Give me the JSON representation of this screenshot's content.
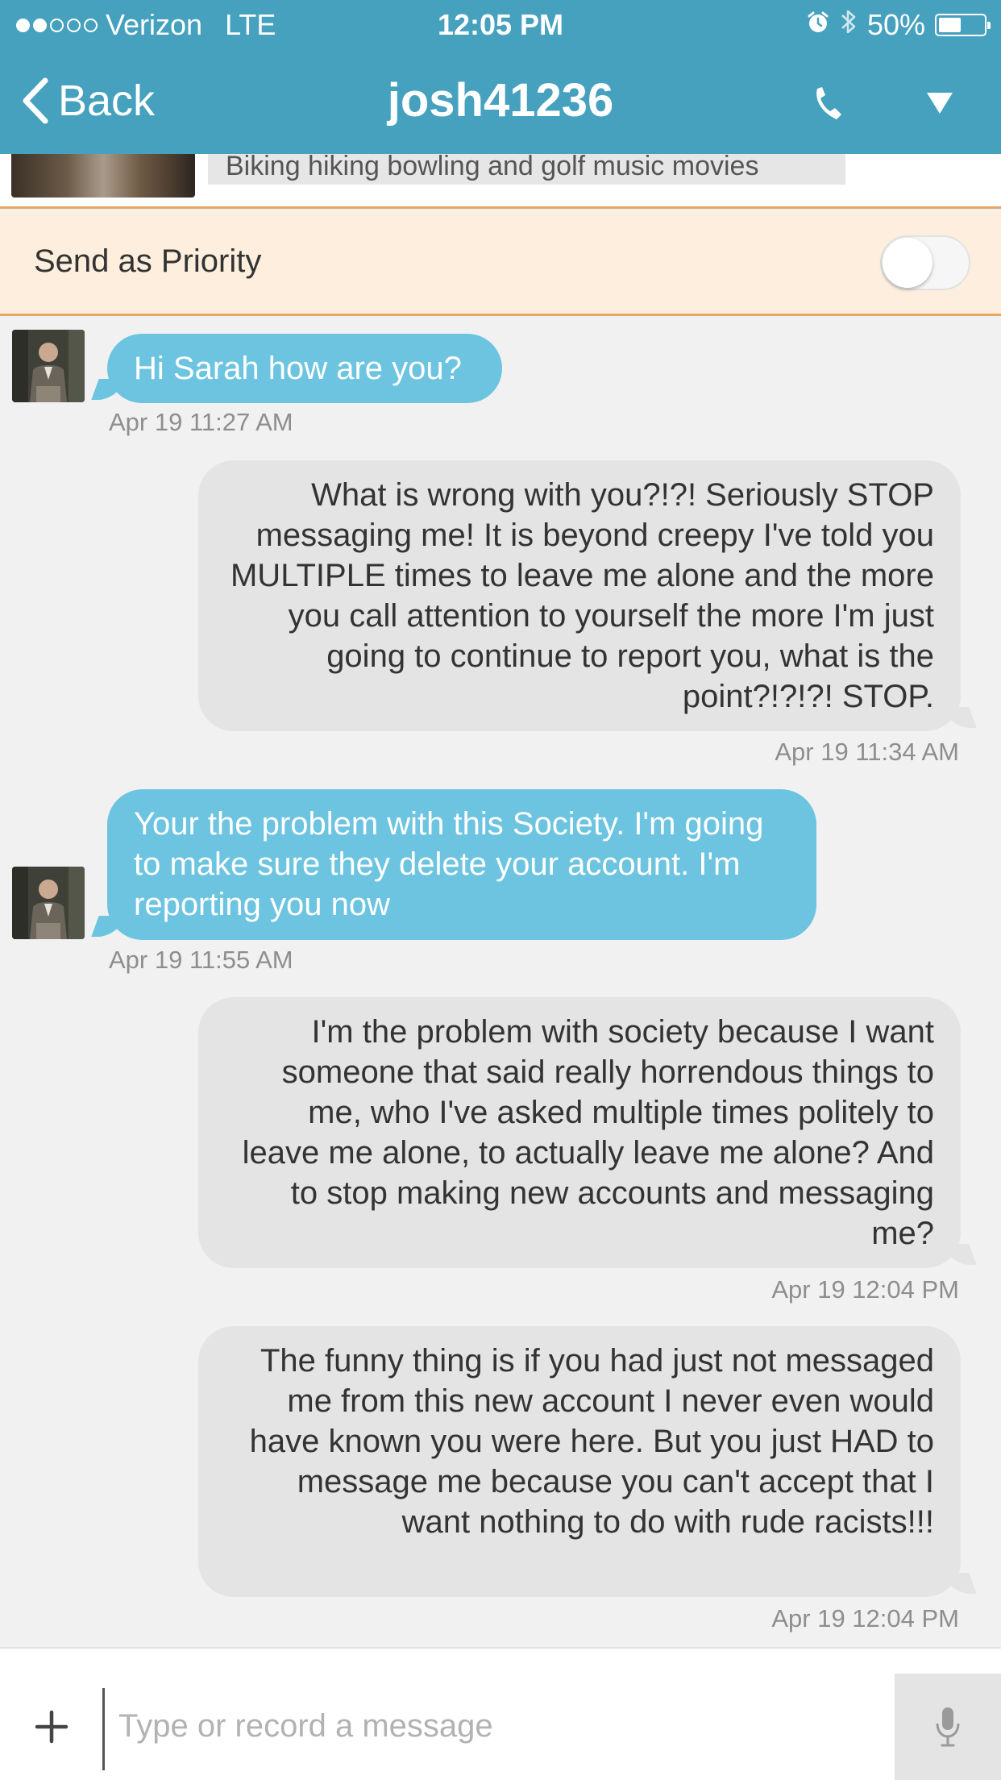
{
  "status_bar": {
    "carrier": "Verizon",
    "network": "LTE",
    "time": "12:05 PM",
    "battery": "50%",
    "battery_level": 0.5,
    "signal_bars_filled": 2,
    "signal_bars_total": 5
  },
  "nav": {
    "back_label": "Back",
    "title": "josh41236",
    "icons": [
      "call-icon",
      "dropdown-caret-icon"
    ]
  },
  "profile": {
    "interests": "Biking hiking bowling and golf music movies"
  },
  "priority": {
    "label": "Send as Priority",
    "enabled": false
  },
  "messages": [
    {
      "direction": "incoming",
      "text": "Hi Sarah how are you?",
      "timestamp": "Apr 19 11:27 AM"
    },
    {
      "direction": "outgoing",
      "text": "What is wrong with you?!?! Seriously STOP messaging me! It is beyond creepy I've told you MULTIPLE times to leave me alone and the more you call attention to yourself the more I'm just going to continue to report you, what is the point?!?!?! STOP.",
      "timestamp": "Apr 19 11:34 AM"
    },
    {
      "direction": "incoming",
      "text": "Your the problem with this Society. I'm going to make sure they delete your account. I'm reporting you now",
      "timestamp": "Apr 19 11:55 AM"
    },
    {
      "direction": "outgoing",
      "text": "I'm the problem with society because I want someone that said really horrendous  things to me, who I've asked multiple times politely to leave me alone, to actually leave me alone? And to stop making new accounts and messaging me?",
      "timestamp": "Apr 19 12:04 PM"
    },
    {
      "direction": "outgoing",
      "text": "The funny thing is if you had just not messaged me from this new account I never even would have known you were here. But you just HAD to message me because you can't accept that I want nothing to do with rude racists!!!",
      "timestamp": "Apr 19 12:04 PM"
    }
  ],
  "composer": {
    "placeholder": "Type or record a message",
    "value": ""
  },
  "colors": {
    "header": "#45a1bd",
    "incoming_bubble": "#6cc4e0",
    "outgoing_bubble": "#e4e4e4",
    "priority_bg": "#fdeedd",
    "priority_border": "#e8a55f"
  }
}
